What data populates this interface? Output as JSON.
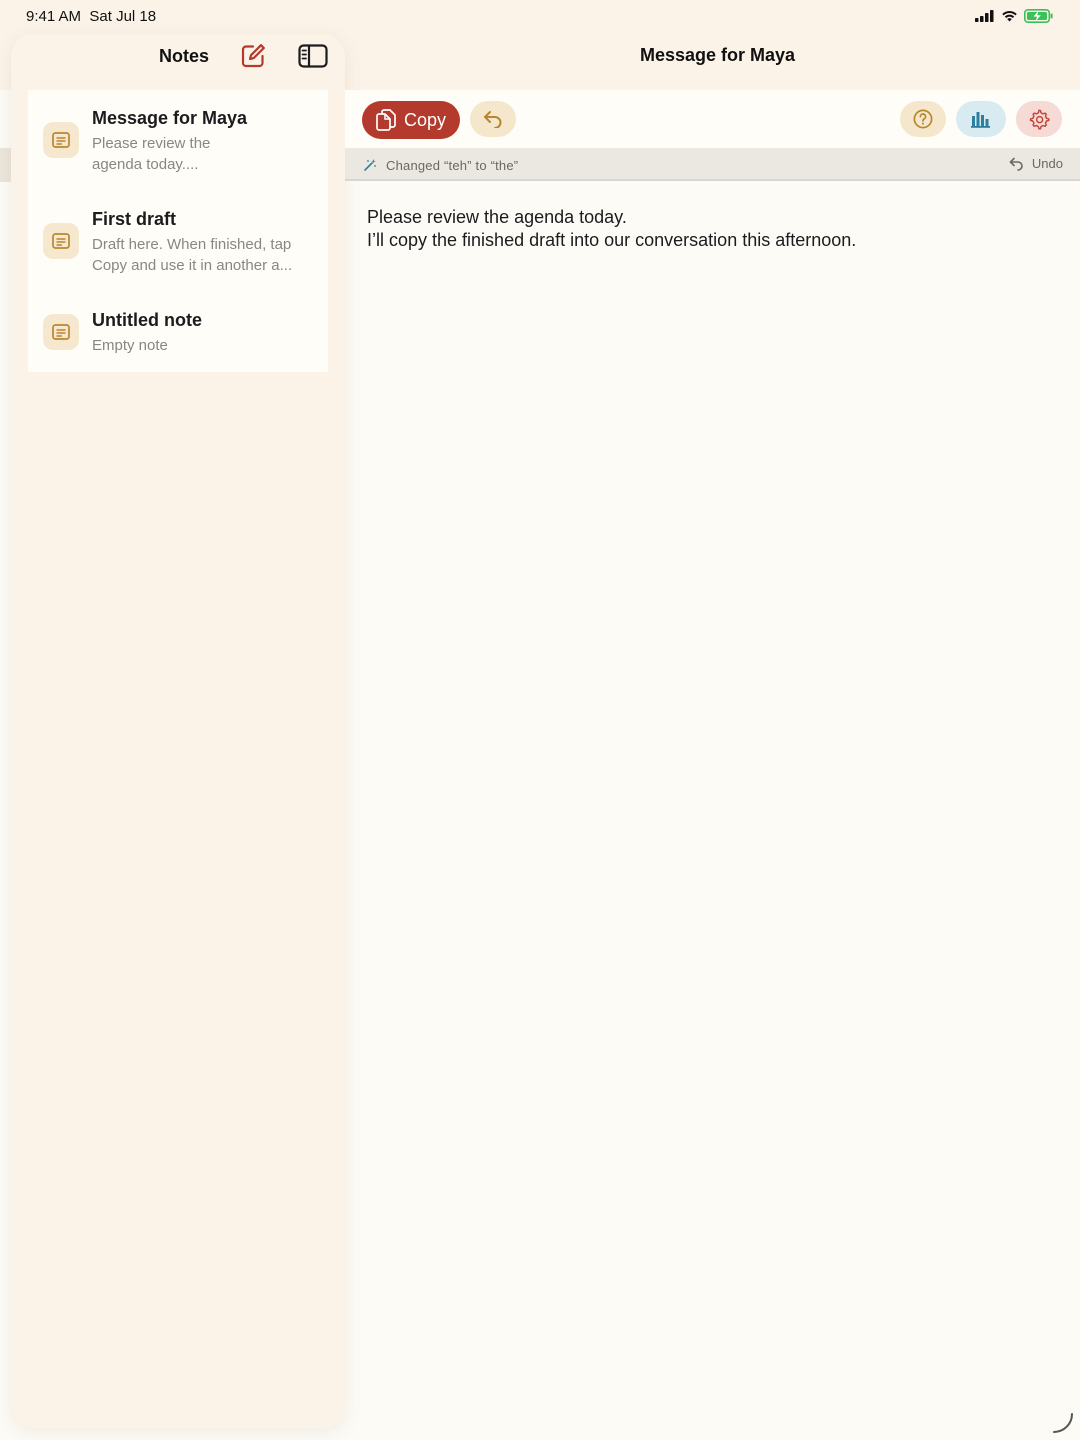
{
  "status_bar": {
    "time": "9:41 AM",
    "date": "Sat Jul 18",
    "icons": [
      "cellular-icon",
      "wifi-icon",
      "battery-charging-icon"
    ]
  },
  "sidebar": {
    "title": "Notes",
    "notes": [
      {
        "title": "Message for Maya",
        "preview": "Please review the agenda today...."
      },
      {
        "title": "First draft",
        "preview": "Draft here. When finished, tap Copy and use it in another a..."
      },
      {
        "title": "Untitled note",
        "preview": "Empty note"
      }
    ]
  },
  "detail": {
    "title": "Message for Maya"
  },
  "toolbar": {
    "copy_label": "Copy"
  },
  "change_bar": {
    "message": "Changed “teh” to “the”",
    "undo_label": "Undo"
  },
  "editor": {
    "lines": [
      "Please review the agenda today.",
      "I’ll copy the finished draft into our conversation this afternoon."
    ]
  },
  "colors": {
    "accent": "#b33a2c",
    "sidebar_bg": "#fcf3e8",
    "page_bg": "#fdfbf6",
    "note_icon_bg": "#f6e8cf",
    "help_pill_bg": "#f5e7cc",
    "stats_pill_bg": "#d8ebf0",
    "settings_pill_bg": "#f6dad6"
  }
}
